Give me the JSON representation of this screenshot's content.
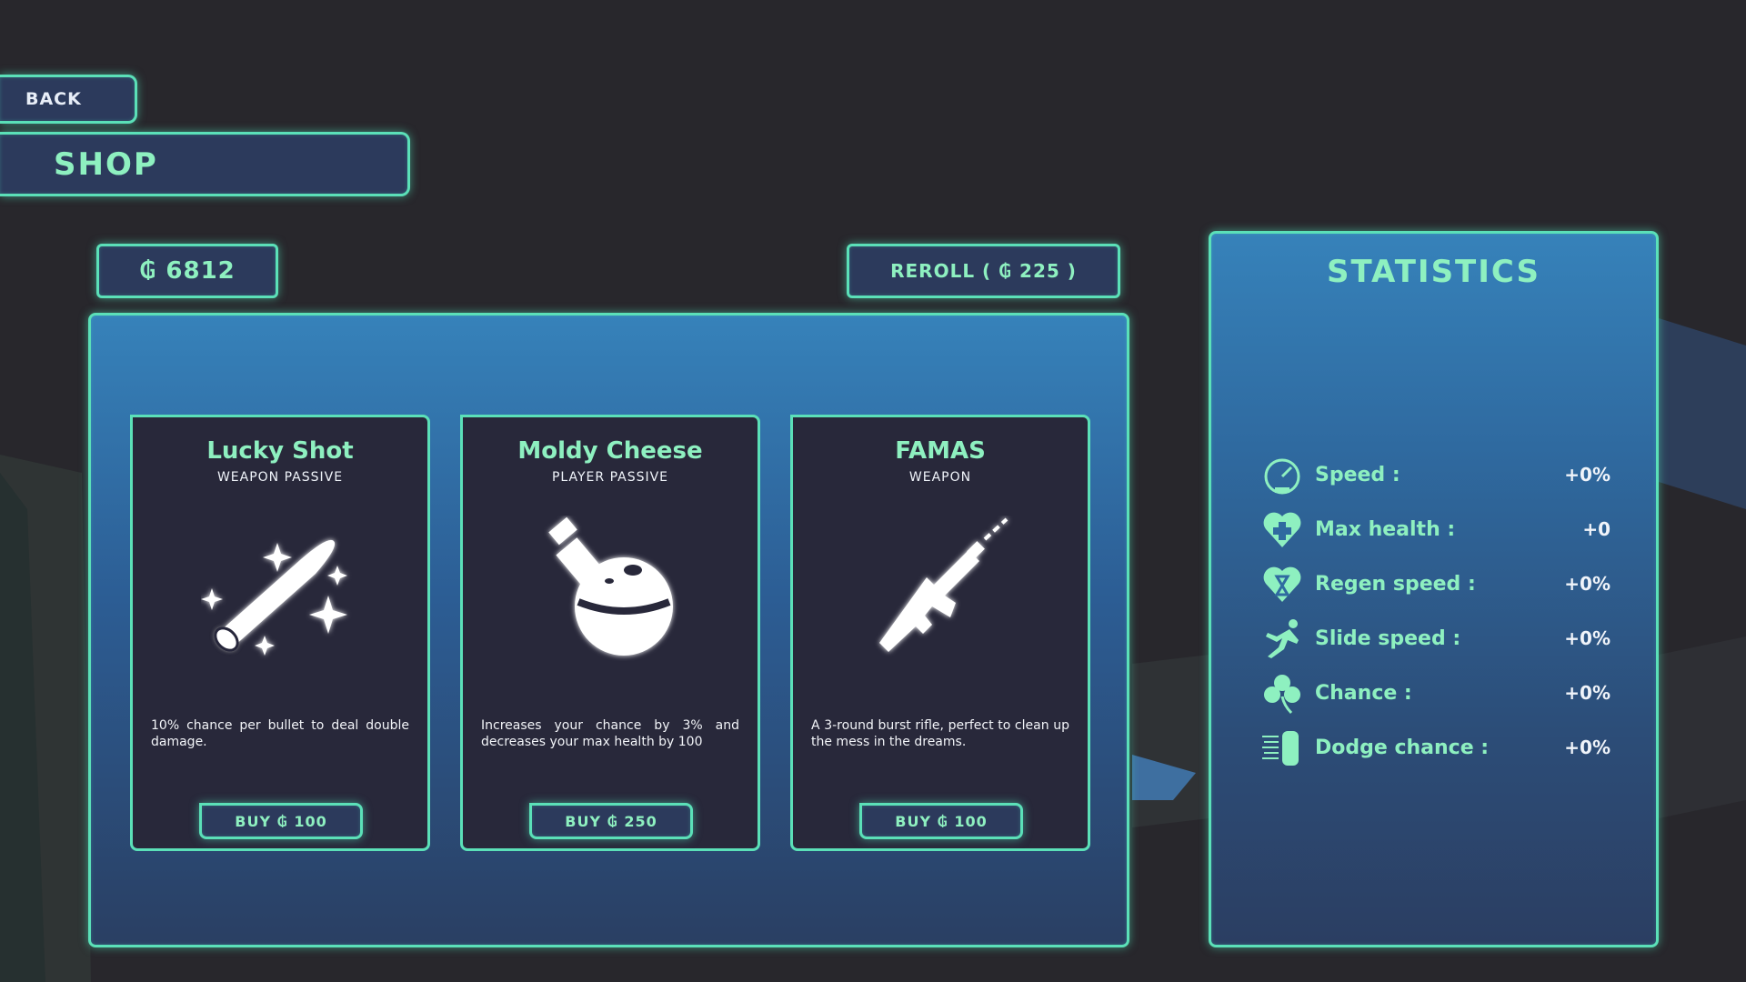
{
  "nav": {
    "back_label": "BACK",
    "title": "SHOP"
  },
  "currency": {
    "symbol": "₲",
    "gold_amount": "6812"
  },
  "reroll": {
    "prefix": "REROLL (",
    "cost": "225",
    "suffix": ")"
  },
  "cards": [
    {
      "name": "Lucky Shot",
      "type": "WEAPON PASSIVE",
      "icon": "bullet-icon",
      "description": "10% chance per bullet to deal double damage.",
      "buy_label": "BUY",
      "price": "100"
    },
    {
      "name": "Moldy Cheese",
      "type": "PLAYER PASSIVE",
      "icon": "potion-icon",
      "description": "Increases your chance by 3% and decreases your max health by 100",
      "buy_label": "BUY",
      "price": "250"
    },
    {
      "name": "FAMAS",
      "type": "WEAPON",
      "icon": "rifle-icon",
      "description": "A 3-round burst rifle, perfect to clean up the mess in the dreams.",
      "buy_label": "BUY",
      "price": "100"
    }
  ],
  "statistics": {
    "title": "STATISTICS",
    "rows": [
      {
        "label": "Speed :",
        "value": "+0%",
        "icon": "speedometer-icon"
      },
      {
        "label": "Max health :",
        "value": "+0",
        "icon": "heart-plus-icon"
      },
      {
        "label": "Regen speed :",
        "value": "+0%",
        "icon": "heart-hourglass-icon"
      },
      {
        "label": "Slide speed :",
        "value": "+0%",
        "icon": "sliding-runner-icon"
      },
      {
        "label": "Chance :",
        "value": "+0%",
        "icon": "clover-icon"
      },
      {
        "label": "Dodge chance :",
        "value": "+0%",
        "icon": "dodge-figure-icon"
      }
    ]
  },
  "colors": {
    "accent": "#8ef0c0",
    "border": "#5be0b8",
    "panel_top": "#3682ba",
    "card_bg": "#28283a",
    "background": "#28272c"
  }
}
